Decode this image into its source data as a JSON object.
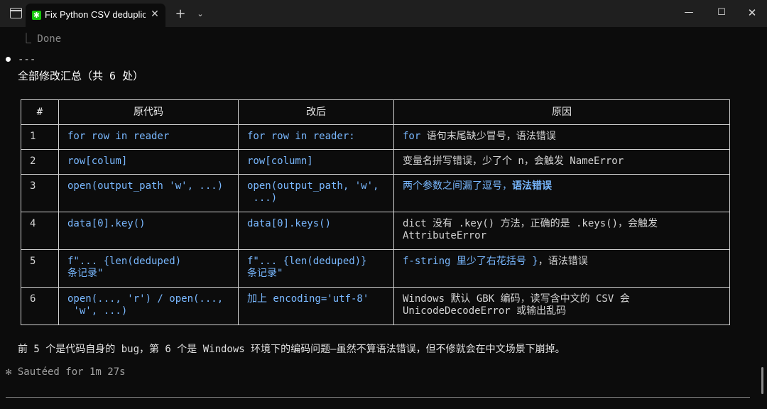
{
  "window": {
    "tab_title": "Fix Python CSV deduplicat",
    "tab_close": "✕",
    "new_tab": "+",
    "dropdown": "⌄",
    "minimize": "—",
    "maximize": "☐",
    "close": "✕"
  },
  "terminal": {
    "done_line": "⎿ Done",
    "separator": "---",
    "summary_title": "全部修改汇总（共 6 处）",
    "table": {
      "headers": [
        "#",
        "原代码",
        "改后",
        "原因"
      ],
      "rows": [
        {
          "num": "1",
          "orig": "for row in reader",
          "fixed": "for row in reader:",
          "reason_code": "for",
          "reason_text": " 语句末尾缺少冒号，语法错误"
        },
        {
          "num": "2",
          "orig": "row[colum]",
          "fixed": "row[column]",
          "reason": "变量名拼写错误，少了个 n，会触发 NameError"
        },
        {
          "num": "3",
          "orig": "open(output_path 'w', ...)",
          "fixed": "open(output_path, 'w',\n ...)",
          "reason_a": "两个参数之间漏了逗号，",
          "reason_b": "语法错误"
        },
        {
          "num": "4",
          "orig": "data[0].key()",
          "fixed": "data[0].keys()",
          "reason": "dict 没有 .key() 方法，正确的是 .keys()，会触发\nAttributeError"
        },
        {
          "num": "5",
          "orig": "f\"... {len(deduped)\n条记录\"",
          "fixed": "f\"... {len(deduped)}\n条记录\"",
          "reason_code": "f-string 里少了右花括号 }",
          "reason_text": "，语法错误"
        },
        {
          "num": "6",
          "orig": "open(..., 'r') / open(...,\n 'w', ...)",
          "fixed": "加上 encoding='utf-8'",
          "reason": "Windows 默认 GBK 编码，读写含中文的 CSV 会\nUnicodeDecodeError 或输出乱码"
        }
      ]
    },
    "footer_note": "前 5 个是代码自身的 bug，第 6 个是 Windows 环境下的编码问题—虽然不算语法错误，但不修就会在中文场景下崩掉。",
    "status_line": "✻ Sautéed for 1m 27s"
  },
  "colors": {
    "background": "#0c0c0c",
    "titlebar": "#1f1f1f",
    "code_accent": "#79b8ff",
    "tab_icon": "#16c60c"
  }
}
